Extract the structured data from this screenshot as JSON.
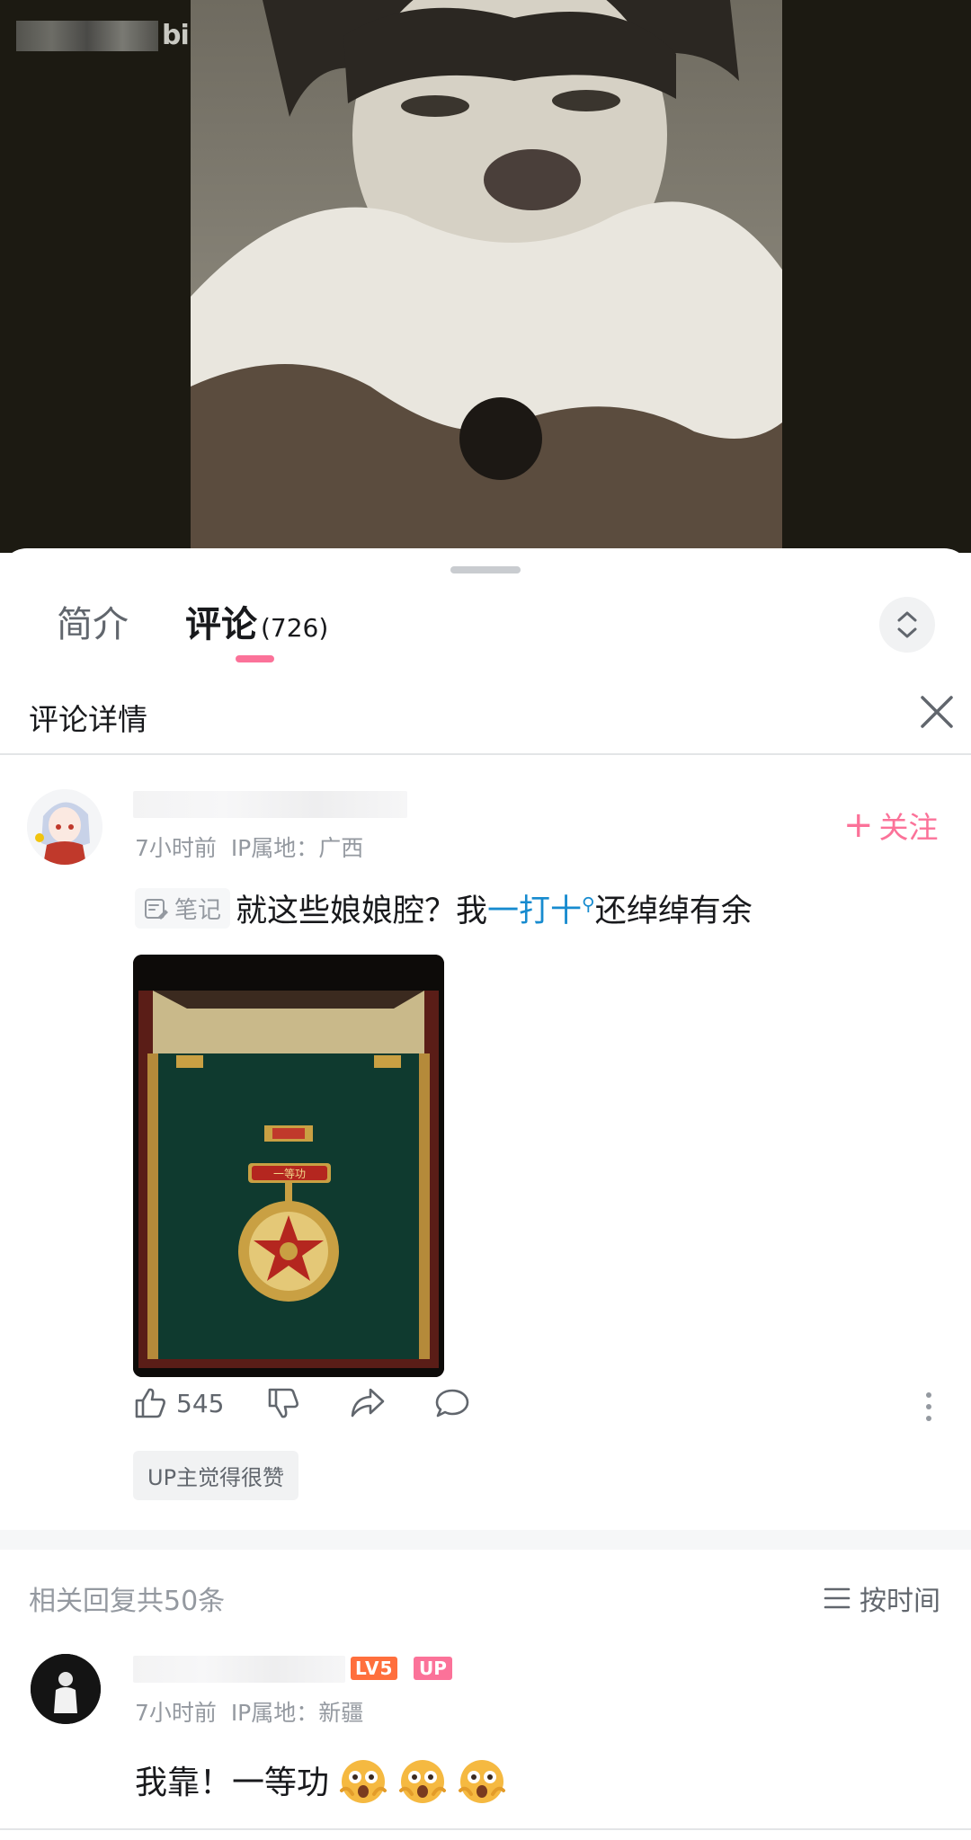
{
  "video": {
    "watermark_logo": "bilibili"
  },
  "tabs": {
    "intro_label": "简介",
    "comments_label": "评论",
    "comments_count": "(726)"
  },
  "detail": {
    "title": "评论详情"
  },
  "main_comment": {
    "time": "7小时前",
    "ip": "IP属地：广西",
    "follow_label": "关注",
    "note_tag": "笔记",
    "text_before": "就这些娘娘腔？我",
    "link_text": "一打十",
    "text_after": "还绰绰有余",
    "like_count": "545",
    "up_liked": "UP主觉得很赞",
    "medal_text": "一等功"
  },
  "replies": {
    "header": "相关回复共50条",
    "sort_label": "按时间"
  },
  "reply": {
    "level_badge": "LV5",
    "up_badge": "UP",
    "time": "7小时前",
    "ip": "IP属地：新疆",
    "text": "我靠！一等功"
  },
  "colors": {
    "accent_pink": "#fb7299",
    "link_blue": "#178bcf",
    "level_orange": "#ff6f3d"
  }
}
